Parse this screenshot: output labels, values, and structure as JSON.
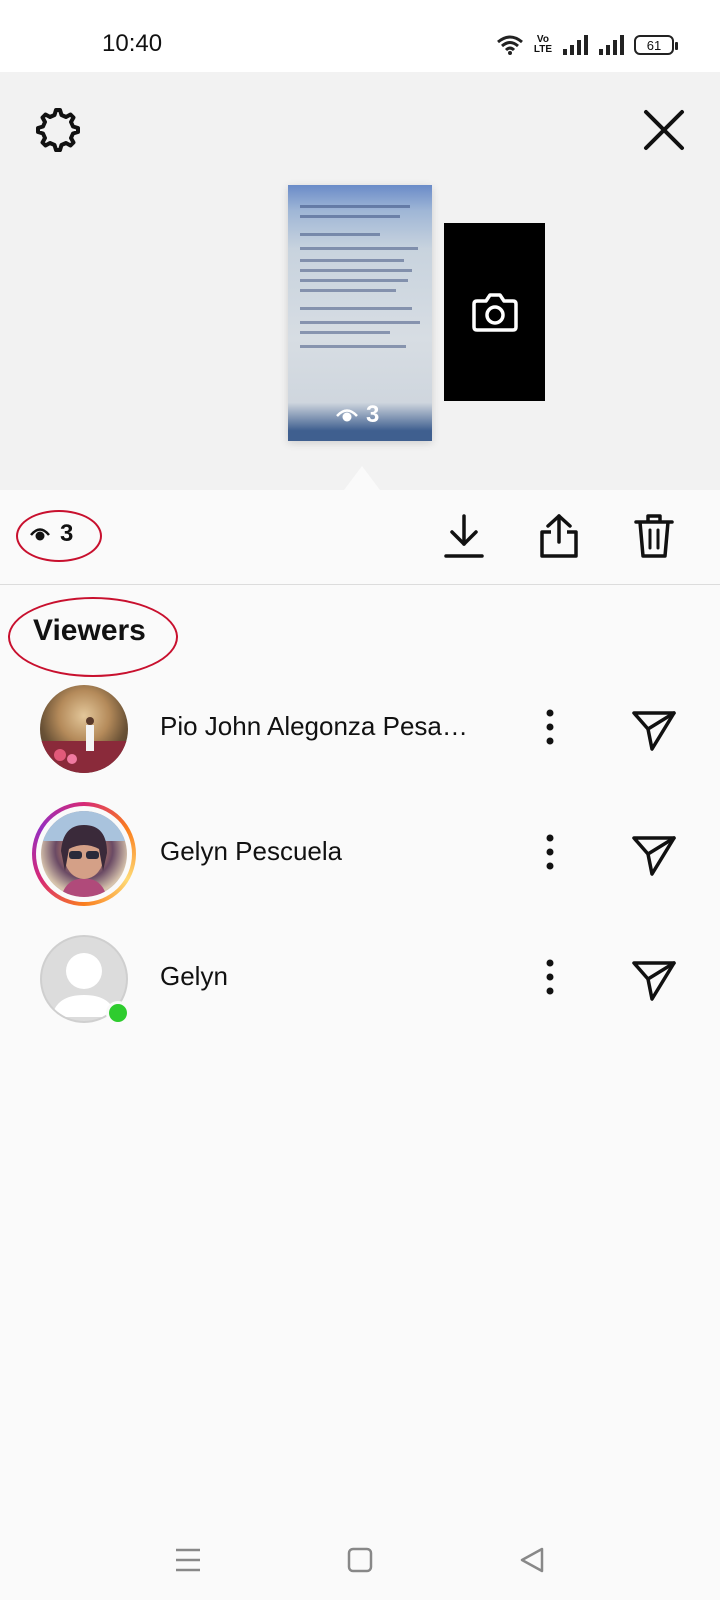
{
  "status_bar": {
    "time": "10:40",
    "network_label_top": "Vo",
    "network_label_bottom": "LTE",
    "battery": "61"
  },
  "story": {
    "views_count": "3"
  },
  "actions": {
    "views_count": "3"
  },
  "viewers": {
    "title": "Viewers",
    "items": [
      {
        "name": "Pio John Alegonza Pesa…",
        "has_story_ring": false,
        "online": false
      },
      {
        "name": "Gelyn Pescuela",
        "has_story_ring": true,
        "online": false
      },
      {
        "name": "Gelyn",
        "has_story_ring": false,
        "online": true
      }
    ]
  },
  "colors": {
    "annotation": "#c8102e",
    "online": "#2ecc2e",
    "panel_bg": "#f2f2f2"
  },
  "icons": [
    "settings-icon",
    "close-icon",
    "camera-icon",
    "eye-icon",
    "download-icon",
    "share-icon",
    "trash-icon",
    "more-vertical-icon",
    "send-icon",
    "menu-icon",
    "home-square-icon",
    "back-triangle-icon"
  ]
}
